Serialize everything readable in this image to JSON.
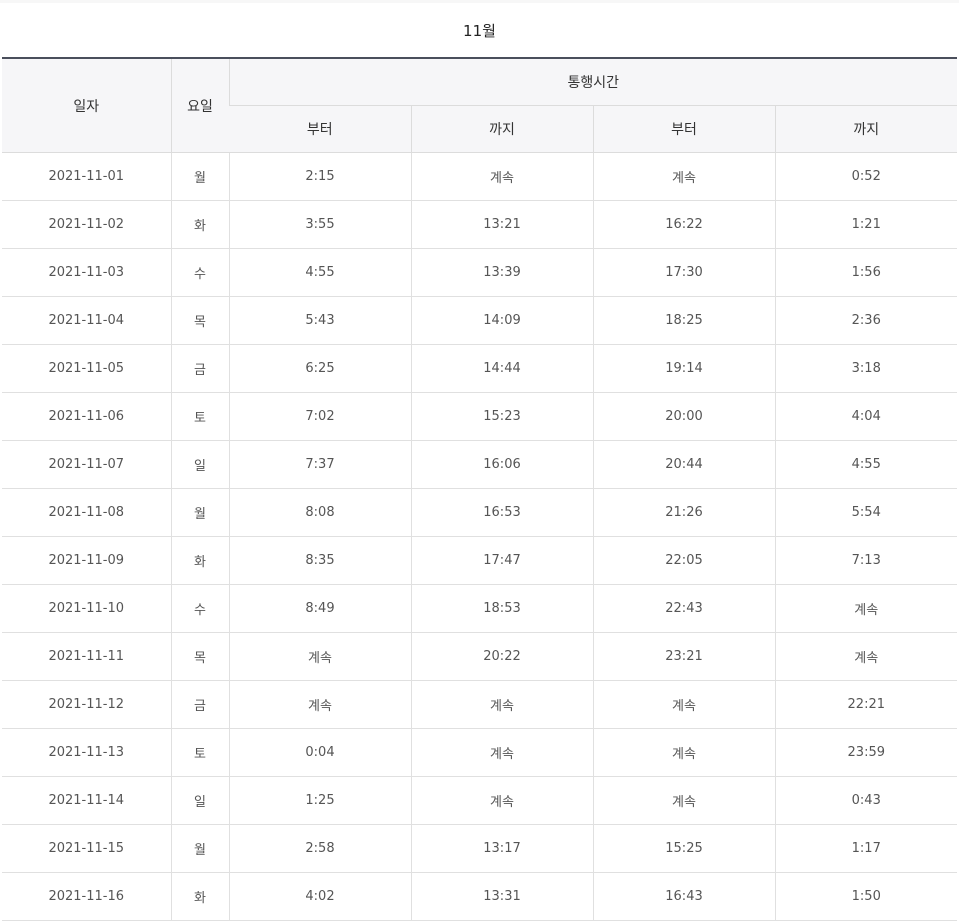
{
  "month_title": "11월",
  "headers": {
    "date": "일자",
    "day": "요일",
    "passage_time": "통행시간",
    "from_1": "부터",
    "to_1": "까지",
    "from_2": "부터",
    "to_2": "까지"
  },
  "rows": [
    {
      "date": "2021-11-01",
      "day": "월",
      "from_1": "2:15",
      "to_1": "계속",
      "from_2": "계속",
      "to_2": "0:52"
    },
    {
      "date": "2021-11-02",
      "day": "화",
      "from_1": "3:55",
      "to_1": "13:21",
      "from_2": "16:22",
      "to_2": "1:21"
    },
    {
      "date": "2021-11-03",
      "day": "수",
      "from_1": "4:55",
      "to_1": "13:39",
      "from_2": "17:30",
      "to_2": "1:56"
    },
    {
      "date": "2021-11-04",
      "day": "목",
      "from_1": "5:43",
      "to_1": "14:09",
      "from_2": "18:25",
      "to_2": "2:36"
    },
    {
      "date": "2021-11-05",
      "day": "금",
      "from_1": "6:25",
      "to_1": "14:44",
      "from_2": "19:14",
      "to_2": "3:18"
    },
    {
      "date": "2021-11-06",
      "day": "토",
      "from_1": "7:02",
      "to_1": "15:23",
      "from_2": "20:00",
      "to_2": "4:04"
    },
    {
      "date": "2021-11-07",
      "day": "일",
      "from_1": "7:37",
      "to_1": "16:06",
      "from_2": "20:44",
      "to_2": "4:55"
    },
    {
      "date": "2021-11-08",
      "day": "월",
      "from_1": "8:08",
      "to_1": "16:53",
      "from_2": "21:26",
      "to_2": "5:54"
    },
    {
      "date": "2021-11-09",
      "day": "화",
      "from_1": "8:35",
      "to_1": "17:47",
      "from_2": "22:05",
      "to_2": "7:13"
    },
    {
      "date": "2021-11-10",
      "day": "수",
      "from_1": "8:49",
      "to_1": "18:53",
      "from_2": "22:43",
      "to_2": "계속"
    },
    {
      "date": "2021-11-11",
      "day": "목",
      "from_1": "계속",
      "to_1": "20:22",
      "from_2": "23:21",
      "to_2": "계속"
    },
    {
      "date": "2021-11-12",
      "day": "금",
      "from_1": "계속",
      "to_1": "계속",
      "from_2": "계속",
      "to_2": "22:21"
    },
    {
      "date": "2021-11-13",
      "day": "토",
      "from_1": "0:04",
      "to_1": "계속",
      "from_2": "계속",
      "to_2": "23:59"
    },
    {
      "date": "2021-11-14",
      "day": "일",
      "from_1": "1:25",
      "to_1": "계속",
      "from_2": "계속",
      "to_2": "0:43"
    },
    {
      "date": "2021-11-15",
      "day": "월",
      "from_1": "2:58",
      "to_1": "13:17",
      "from_2": "15:25",
      "to_2": "1:17"
    },
    {
      "date": "2021-11-16",
      "day": "화",
      "from_1": "4:02",
      "to_1": "13:31",
      "from_2": "16:43",
      "to_2": "1:50"
    }
  ]
}
